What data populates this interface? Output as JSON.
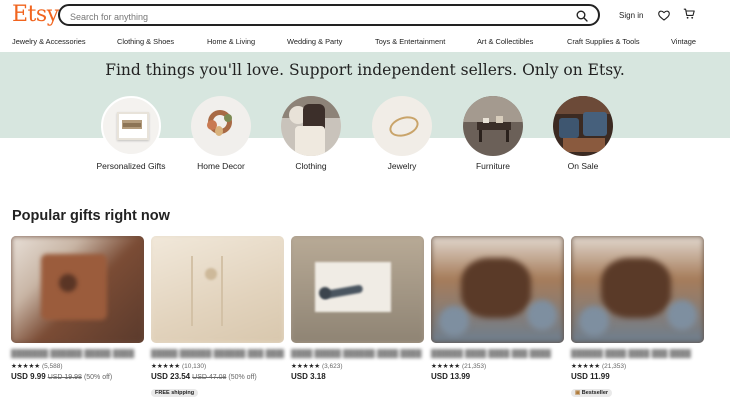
{
  "header": {
    "logo": "Etsy",
    "search_placeholder": "Search for anything",
    "signin": "Sign in"
  },
  "categories": [
    "Jewelry & Accessories",
    "Clothing & Shoes",
    "Home & Living",
    "Wedding & Party",
    "Toys & Entertainment",
    "Art & Collectibles",
    "Craft Supplies & Tools",
    "Vintage"
  ],
  "hero": {
    "tagline": "Find things you'll love. Support independent sellers. Only on Etsy.",
    "circles": [
      {
        "label": "Personalized Gifts"
      },
      {
        "label": "Home Decor"
      },
      {
        "label": "Clothing"
      },
      {
        "label": "Jewelry"
      },
      {
        "label": "Furniture"
      },
      {
        "label": "On Sale"
      }
    ]
  },
  "popular": {
    "title": "Popular gifts right now",
    "items": [
      {
        "stars": "★★★★★",
        "count": "(5,588)",
        "price": "USD 9.99",
        "orig": "USD 19.98",
        "off": "(50% off)",
        "badge": ""
      },
      {
        "stars": "★★★★★",
        "count": "(10,130)",
        "price": "USD 23.54",
        "orig": "USD 47.08",
        "off": "(50% off)",
        "badge": "FREE shipping"
      },
      {
        "stars": "★★★★★",
        "count": "(3,623)",
        "price": "USD 3.18",
        "orig": "",
        "off": "",
        "badge": ""
      },
      {
        "stars": "★★★★★",
        "count": "(21,353)",
        "price": "USD 13.99",
        "orig": "",
        "off": "",
        "badge": ""
      },
      {
        "stars": "★★★★★",
        "count": "(21,353)",
        "price": "USD 11.99",
        "orig": "",
        "off": "",
        "badge": "Bestseller"
      }
    ]
  },
  "colors": {
    "brand": "#f1641e",
    "hero_band": "#d7e6df"
  },
  "icons": [
    "search-icon",
    "heart-icon",
    "cart-icon"
  ]
}
